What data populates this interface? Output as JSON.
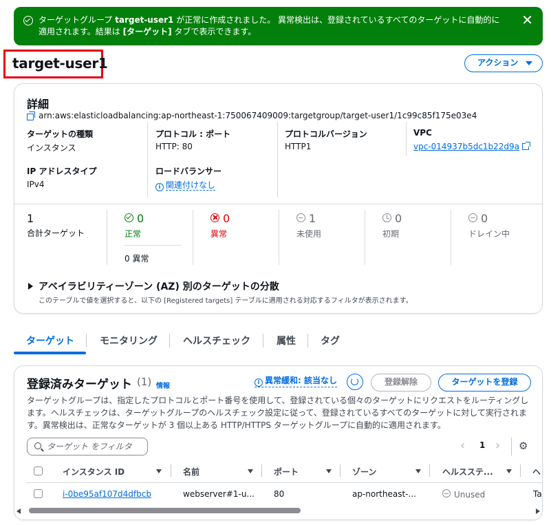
{
  "flash": {
    "line1_pre": "ターゲットグループ ",
    "line1_name": "target-user1",
    "line1_post": " が正常に作成されました。 異常検出は、登録されているすべてのターゲットに自動的に",
    "line2_pre": "適用されます。結果は ",
    "line2_tab": "[ターゲット]",
    "line2_post": " タブで表示できます。",
    "close": "✕"
  },
  "page": {
    "title": "target-user1",
    "action_button": "アクション"
  },
  "details": {
    "heading": "詳細",
    "arn": "arn:aws:elasticloadbalancing:ap-northeast-1:750067409009:targetgroup/target-user1/1c99c85f175e03e4",
    "target_type_label": "ターゲットの種類",
    "target_type_value": "インスタンス",
    "protocol_label": "プロトコル : ポート",
    "protocol_value": "HTTP: 80",
    "protocol_version_label": "プロトコルバージョン",
    "protocol_version_value": "HTTP1",
    "vpc_label": "VPC",
    "vpc_value": "vpc-014937b5dc1b22d9a",
    "ip_type_label": "IP アドレスタイプ",
    "ip_type_value": "IPv4",
    "lb_label": "ロードバランサー",
    "lb_value": "関連付けなし"
  },
  "stats": {
    "total_num": "1",
    "total_label": "合計ターゲット",
    "healthy_num": "0",
    "healthy_label": "正常",
    "anomalous": "0 異常",
    "unhealthy_num": "0",
    "unhealthy_label": "異常",
    "unused_num": "1",
    "unused_label": "未使用",
    "initial_num": "0",
    "initial_label": "初期",
    "draining_num": "0",
    "draining_label": "ドレイン中"
  },
  "az": {
    "title": "アベイラビリティーゾーン (AZ) 別のターゲットの分散",
    "desc": "このテーブルで値を選択すると、以下の [Registered targets] テーブルに適用される対応するフィルタが表示されます。"
  },
  "tabs": [
    "ターゲット",
    "モニタリング",
    "ヘルスチェック",
    "属性",
    "タグ"
  ],
  "targets": {
    "heading": "登録済みターゲット",
    "count": "(1)",
    "info": "情報",
    "mitigation": "異常緩和: 該当なし",
    "deregister": "登録解除",
    "register": "ターゲットを登録",
    "desc": "ターゲットグループは、指定したプロトコルとポート番号を使用して、登録されている個々のターゲットにリクエストをルーティングします。ヘルスチェックは、ターゲットグループのヘルスチェック設定に従って、登録されているすべてのターゲットに対して実行されます。異常検出は、正常なターゲットが 3 個以上ある HTTP/HTTPS ターゲットグループに自動的に適用されます。",
    "filter_placeholder": "ターゲット をフィルタ",
    "page": "1",
    "columns": [
      "インスタンス ID",
      "名前",
      "ポート",
      "ゾーン",
      "ヘルスステ...",
      "ヘ"
    ],
    "row": {
      "instance_id": "i-0be95af107d4dfbcb",
      "name": "webserver#1-u...",
      "port": "80",
      "zone": "ap-northeast-...",
      "health": "Unused",
      "extra": "Tar"
    }
  },
  "colors": {
    "success": "#037f0c",
    "link": "#006ce0",
    "error": "#db0000",
    "highlight": "#e5000f"
  }
}
